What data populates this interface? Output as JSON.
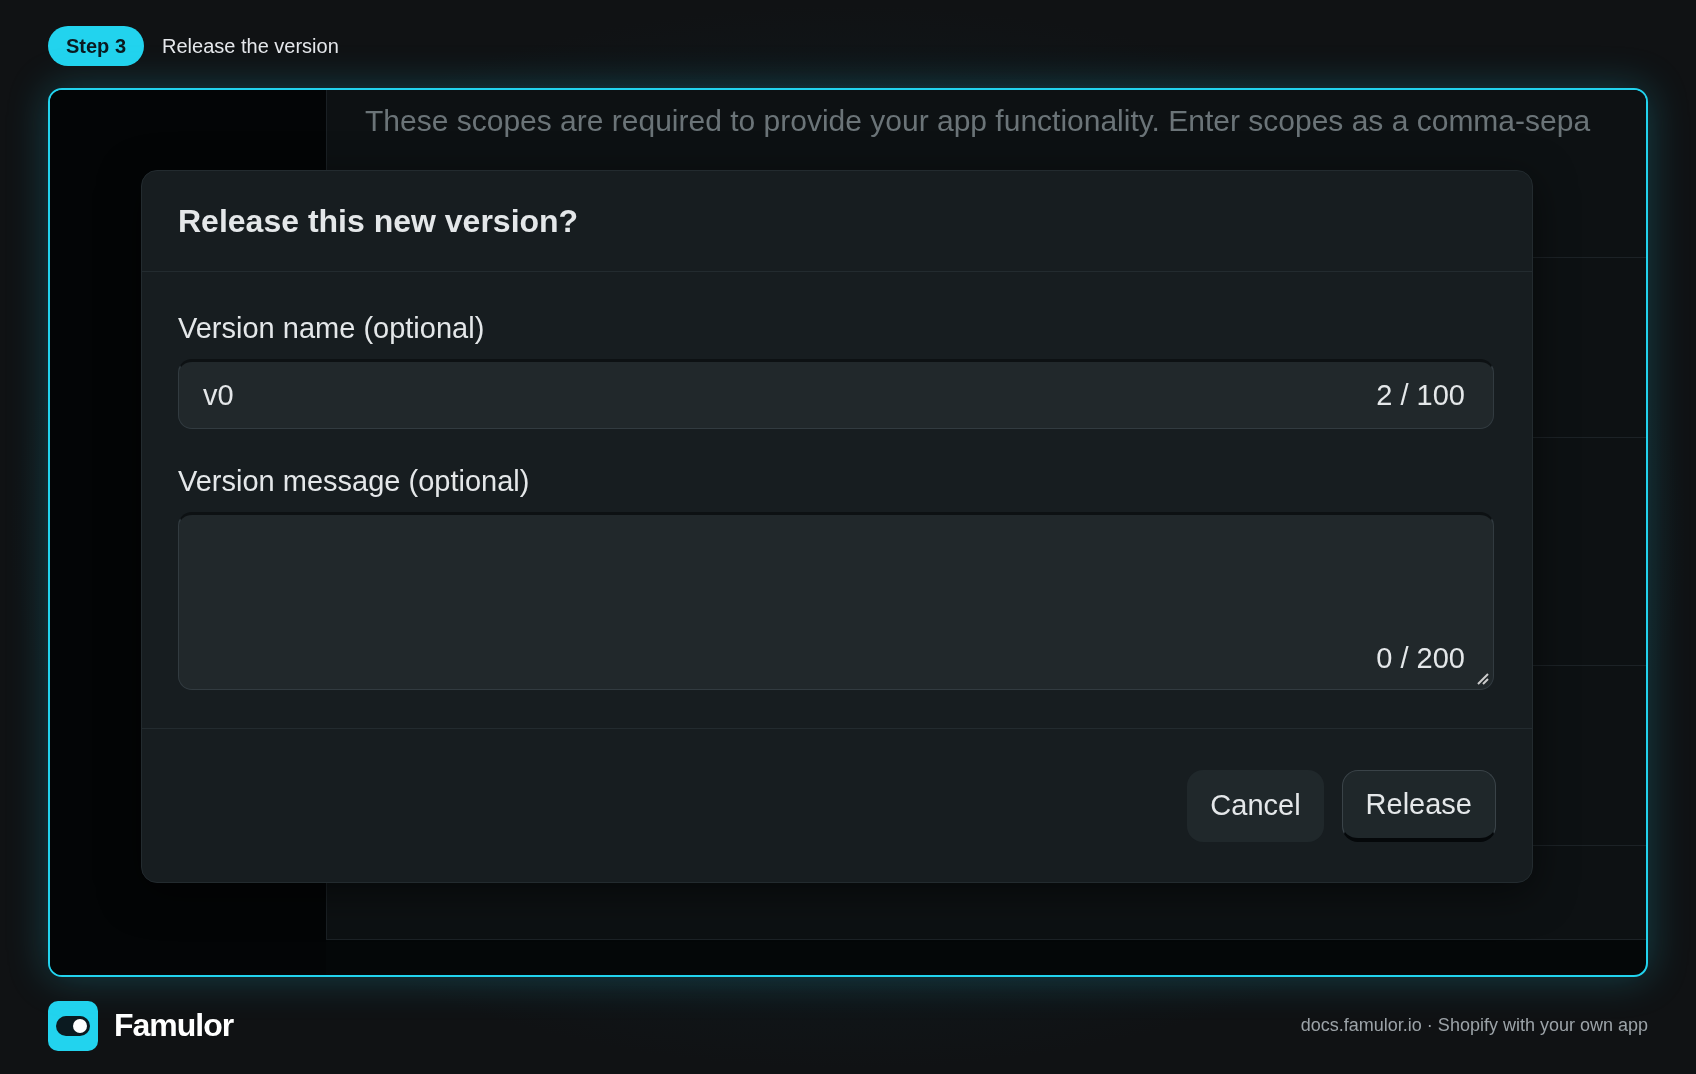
{
  "step": {
    "badge": "Step 3",
    "title": "Release the version"
  },
  "background": {
    "description": "These scopes are required to provide your app functionality. Enter scopes as a comma-sepa"
  },
  "dialog": {
    "title": "Release this new version?",
    "fields": [
      {
        "kind": "input",
        "label": "Version name (optional)",
        "value": "v0",
        "counter": "2 / 100"
      },
      {
        "kind": "textarea",
        "label": "Version message (optional)",
        "counter": "0 / 200"
      }
    ],
    "buttons": [
      {
        "label": "Cancel",
        "kind": "secondary"
      },
      {
        "label": "Release",
        "kind": "primary"
      }
    ]
  },
  "footer": {
    "brand": "Famulor",
    "caption": "docs.famulor.io · Shopify with your own app"
  }
}
